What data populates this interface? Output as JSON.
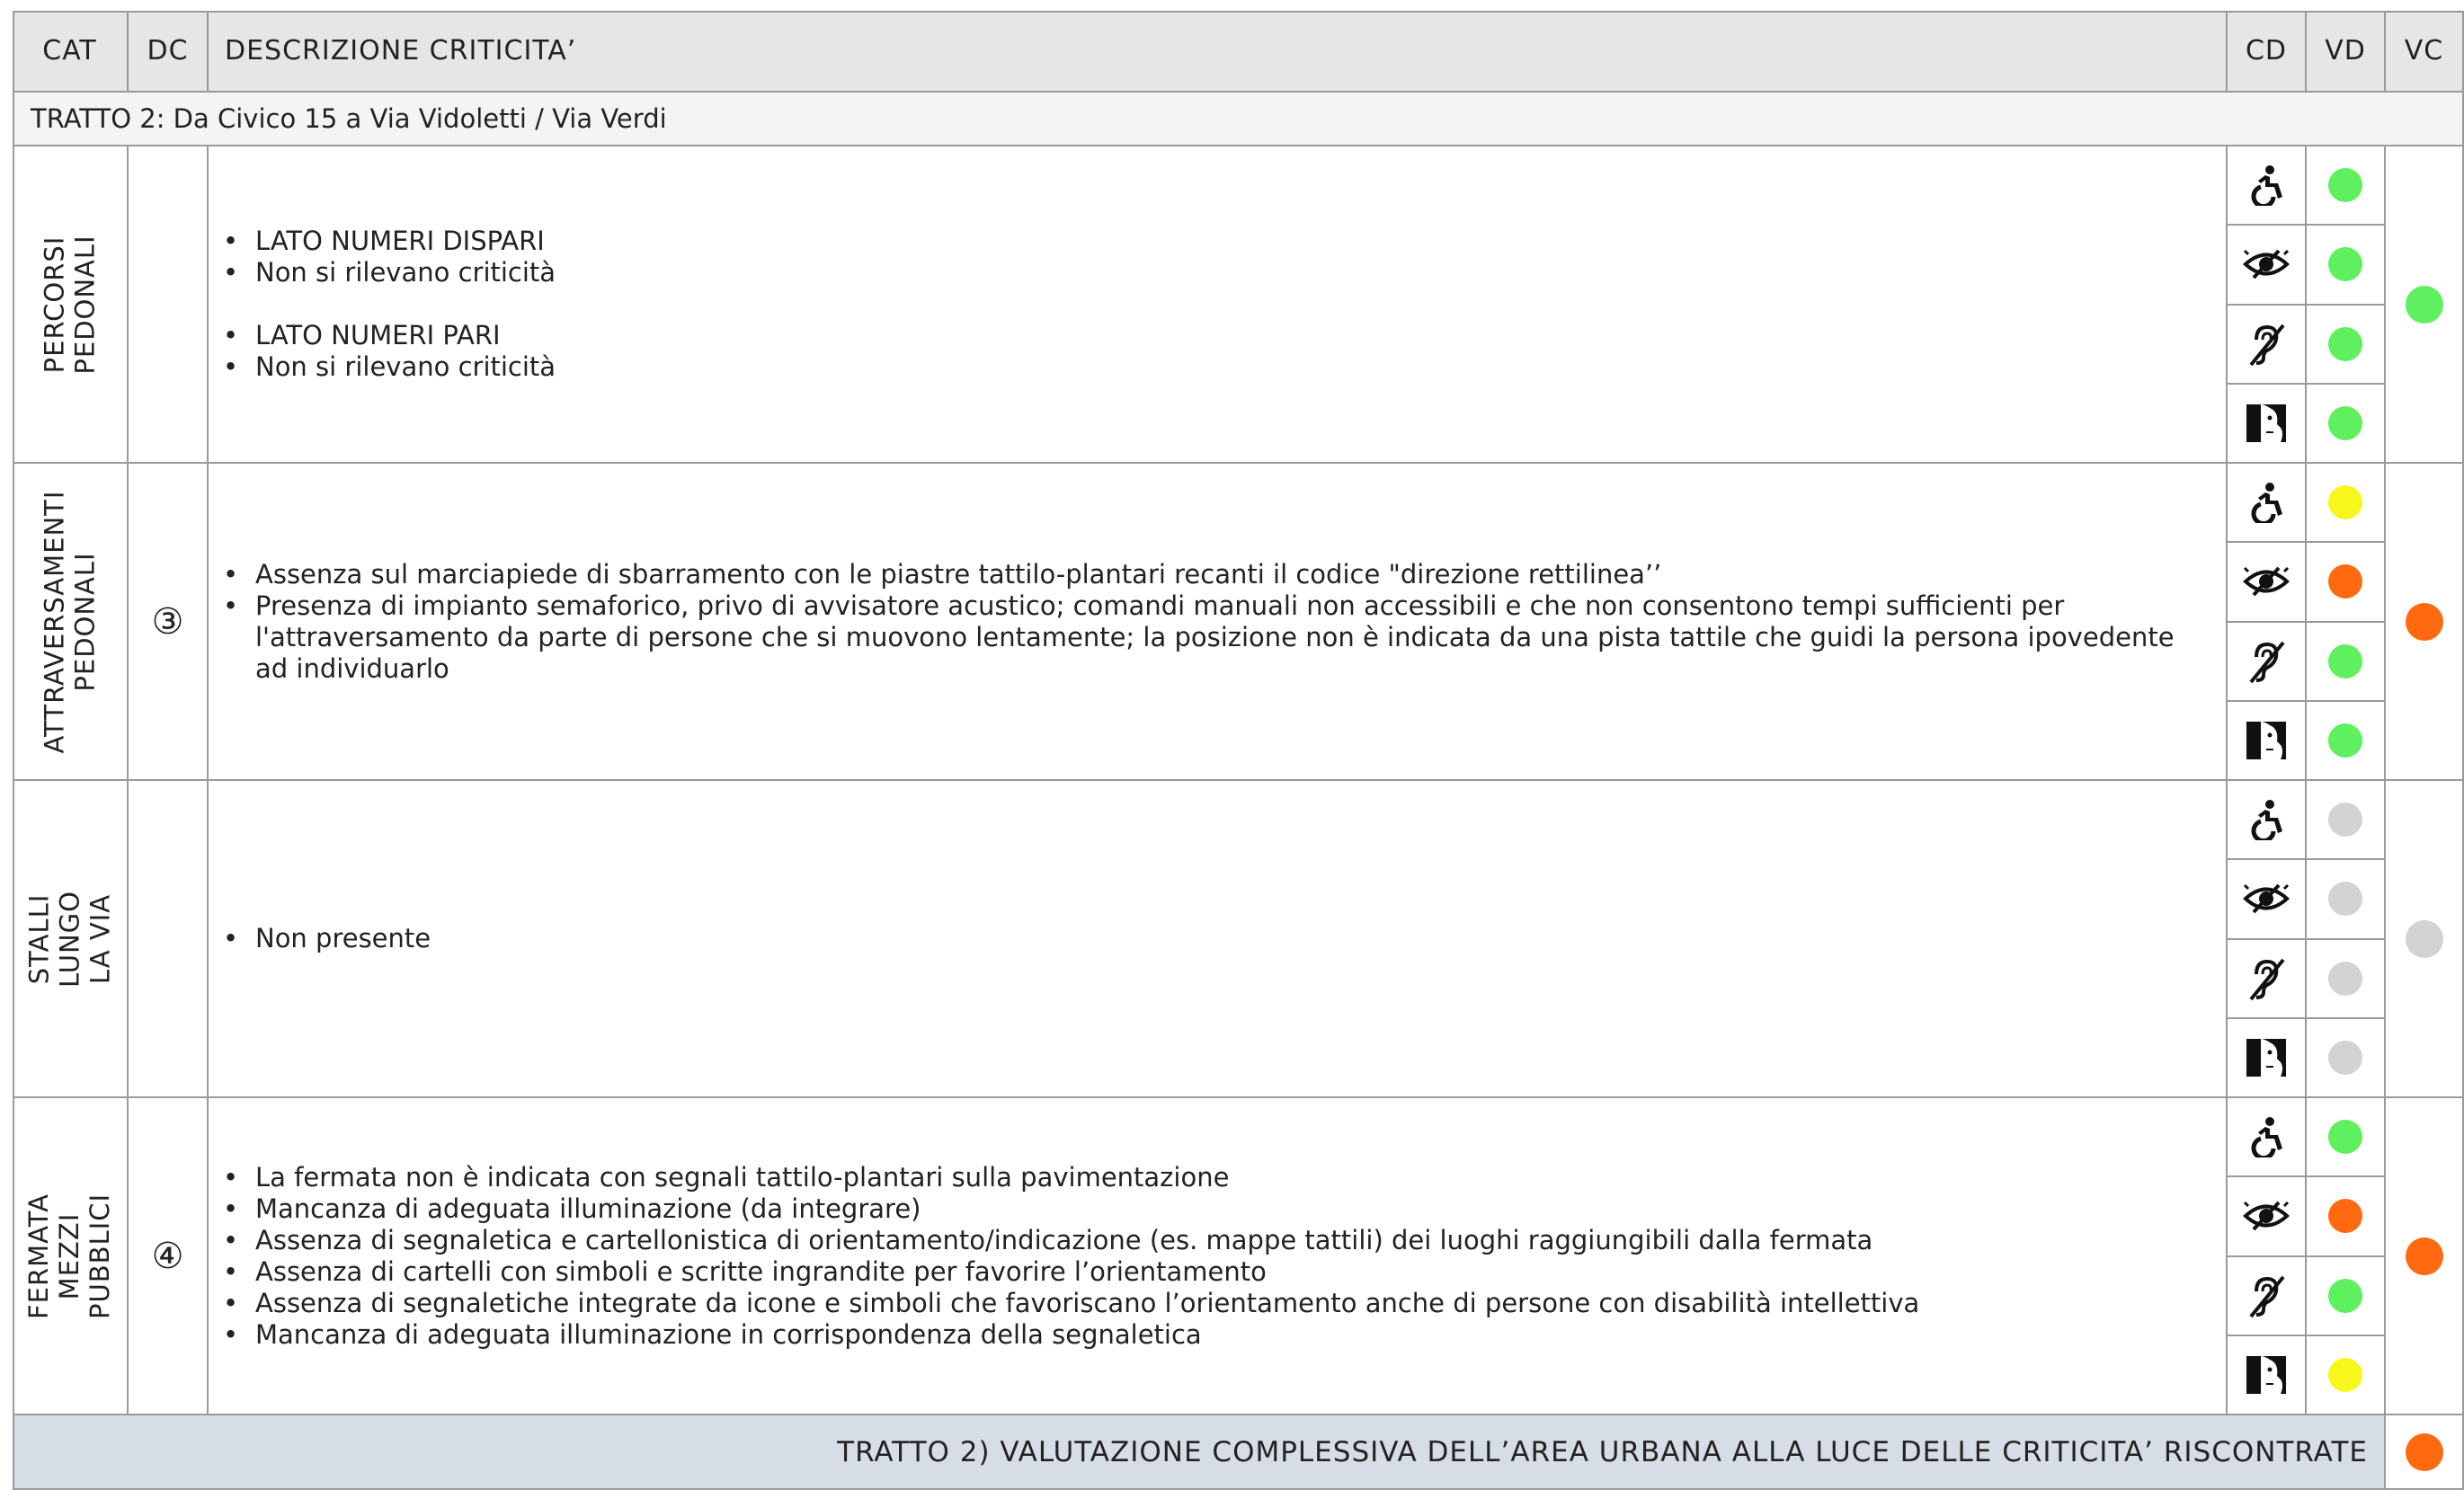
{
  "header": {
    "cat": "CAT",
    "dc": "DC",
    "desc": "DESCRIZIONE CRITICITA’",
    "cd": "CD",
    "vd": "VD",
    "vc": "VC"
  },
  "section_title": "TRATTO 2: Da Civico 15 a Via Vidoletti / Via Verdi",
  "colors": {
    "green": "#5ef05e",
    "yellow": "#f7f71b",
    "orange": "#ff6a10",
    "grey": "#d3d3d3",
    "header_bg": "#e6e6e6",
    "footer_bg": "#d6dde6"
  },
  "disability_icons": [
    "wheelchair-icon",
    "visual-impairment-icon",
    "hearing-impairment-icon",
    "cognitive-disability-icon"
  ],
  "rows": [
    {
      "category": "PERCORSI PEDONALI",
      "dc": "",
      "groups": [
        [
          "LATO NUMERI DISPARI",
          "Non si rilevano criticità"
        ],
        [
          "LATO NUMERI PARI",
          "Non si rilevano criticità"
        ]
      ],
      "vd": [
        "green",
        "green",
        "green",
        "green"
      ],
      "vc": "green"
    },
    {
      "category": "ATTRAVERSAMENTI PEDONALI",
      "dc": "③",
      "groups": [
        [
          "Assenza sul marciapiede di sbarramento con le piastre tattilo-plantari recanti il codice \"direzione rettilinea’’",
          "Presenza di impianto semaforico, privo di avvisatore acustico; comandi manuali non accessibili e che non consentono tempi sufficienti per l'attraversamento da parte di persone che si muovono lentamente; la posizione non è indicata da una pista tattile che guidi la persona ipovedente ad individuarlo"
        ]
      ],
      "vd": [
        "yellow",
        "orange",
        "green",
        "green"
      ],
      "vc": "orange"
    },
    {
      "category": "STALLI LUNGO LA VIA",
      "dc": "",
      "groups": [
        [
          "Non presente"
        ]
      ],
      "vd": [
        "grey",
        "grey",
        "grey",
        "grey"
      ],
      "vc": "grey"
    },
    {
      "category": "FERMATA MEZZI PUBBLICI",
      "dc": "④",
      "groups": [
        [
          "La fermata non è indicata con segnali tattilo-plantari sulla pavimentazione",
          "Mancanza di adeguata illuminazione (da integrare)",
          "Assenza di segnaletica e cartellonistica di orientamento/indicazione (es. mappe tattili) dei luoghi raggiungibili dalla fermata",
          "Assenza di cartelli con simboli e scritte ingrandite per favorire l’orientamento",
          "Assenza di segnaletiche integrate da icone e simboli che favoriscano l’orientamento anche di persone con disabilità intellettiva",
          "Mancanza di adeguata illuminazione in corrispondenza della segnaletica"
        ]
      ],
      "vd": [
        "green",
        "orange",
        "green",
        "yellow"
      ],
      "vc": "orange"
    }
  ],
  "footer": {
    "text": "TRATTO 2) VALUTAZIONE COMPLESSIVA DELL’AREA URBANA ALLA LUCE DELLE CRITICITA’ RISCONTRATE",
    "vc": "orange"
  }
}
